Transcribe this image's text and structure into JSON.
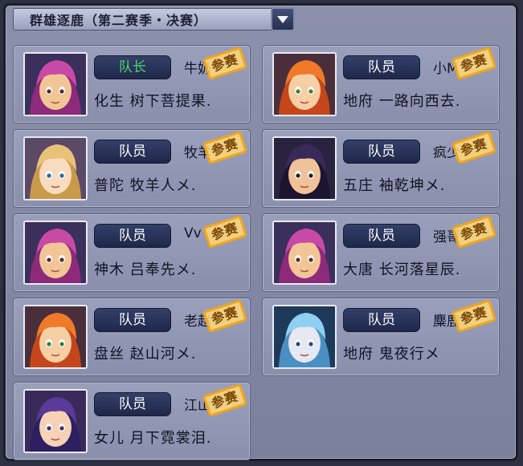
{
  "title": "群雄逐鹿（第二赛季・决赛）",
  "stamp_label": "参赛",
  "members": [
    {
      "role": "队长",
      "name": "牛奶",
      "school": "化生",
      "nick": "树下菩提果.",
      "leader": true,
      "avatar": "pink-hair-boy-avatar"
    },
    {
      "role": "队员",
      "name": "小M",
      "school": "地府",
      "nick": "一路向西去.",
      "leader": false,
      "avatar": "orange-hair-avatar"
    },
    {
      "role": "队员",
      "name": "牧羊",
      "school": "普陀",
      "nick": "牧羊人メ.",
      "leader": false,
      "avatar": "blonde-girl-avatar"
    },
    {
      "role": "队员",
      "name": "疯少",
      "school": "五庄",
      "nick": "袖乾坤メ.",
      "leader": false,
      "avatar": "dark-hair-boy-avatar"
    },
    {
      "role": "队员",
      "name": "Vv",
      "school": "神木",
      "nick": "吕奉先メ.",
      "leader": false,
      "avatar": "pink-hair-boy-avatar"
    },
    {
      "role": "队员",
      "name": "强哥",
      "school": "大唐",
      "nick": "长河落星辰.",
      "leader": false,
      "avatar": "pink-hair-boy-avatar"
    },
    {
      "role": "队员",
      "name": "老赵",
      "school": "盘丝",
      "nick": "赵山河メ.",
      "leader": false,
      "avatar": "orange-hair-avatar"
    },
    {
      "role": "队员",
      "name": "麋鹿",
      "school": "地府",
      "nick": "鬼夜行メ",
      "leader": false,
      "avatar": "blue-hair-avatar"
    },
    {
      "role": "队员",
      "name": "江山",
      "school": "女儿",
      "nick": "月下霓裳泪.",
      "leader": false,
      "avatar": "purple-hair-girl-avatar"
    }
  ],
  "colors": {
    "leader_role": "#48d86a",
    "member_role": "#ffffff",
    "stamp": "#f1a51c"
  }
}
